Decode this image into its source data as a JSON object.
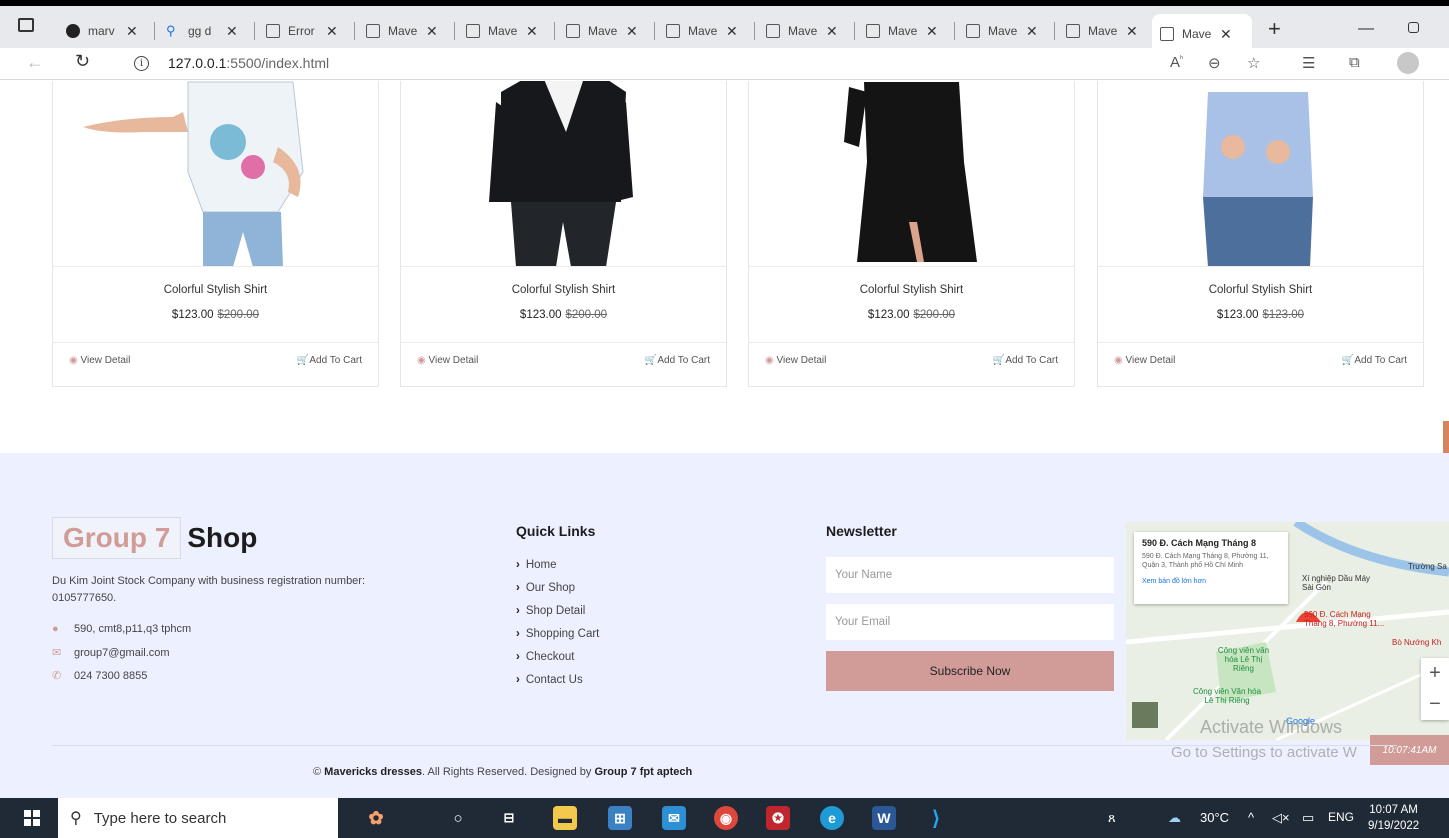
{
  "browser": {
    "tabs": [
      {
        "label": "marv",
        "icon": "github-icon"
      },
      {
        "label": "gg d",
        "icon": "search-icon"
      },
      {
        "label": "Error",
        "icon": "page-icon"
      },
      {
        "label": "Mave",
        "icon": "page-icon"
      },
      {
        "label": "Mave",
        "icon": "page-icon"
      },
      {
        "label": "Mave",
        "icon": "page-icon"
      },
      {
        "label": "Mave",
        "icon": "page-icon"
      },
      {
        "label": "Mave",
        "icon": "page-icon"
      },
      {
        "label": "Mave",
        "icon": "page-icon"
      },
      {
        "label": "Mave",
        "icon": "page-icon"
      },
      {
        "label": "Mave",
        "icon": "page-icon"
      },
      {
        "label": "Mave",
        "icon": "page-icon",
        "active": true
      }
    ],
    "url_host": "127.0.0.1",
    "url_path": ":5500/index.html"
  },
  "products": [
    {
      "name": "Colorful Stylish Shirt",
      "price": "$123.00",
      "old_price": "$200.00",
      "view": "View Detail",
      "cart": "Add To Cart"
    },
    {
      "name": "Colorful Stylish Shirt",
      "price": "$123.00",
      "old_price": "$200.00",
      "view": "View Detail",
      "cart": "Add To Cart"
    },
    {
      "name": "Colorful Stylish Shirt",
      "price": "$123.00",
      "old_price": "$200.00",
      "view": "View Detail",
      "cart": "Add To Cart"
    },
    {
      "name": "Colorful Stylish Shirt",
      "price": "$123.00",
      "old_price": "$123.00",
      "view": "View Detail",
      "cart": "Add To Cart"
    }
  ],
  "footer": {
    "logo_accent": "Group 7",
    "logo_rest": "Shop",
    "about": "Du Kim Joint Stock Company with business registration number: 0105777650.",
    "address": "590, cmt8,p11,q3 tphcm",
    "email": "group7@gmail.com",
    "phone": "024 7300 8855",
    "quick_links_title": "Quick Links",
    "quick_links": [
      "Home",
      "Our Shop",
      "Shop Detail",
      "Shopping Cart",
      "Checkout",
      "Contact Us"
    ],
    "newsletter_title": "Newsletter",
    "name_placeholder": "Your Name",
    "email_placeholder": "Your Email",
    "subscribe": "Subscribe Now",
    "copyright_symbol": "©",
    "copyright_brand": "Mavericks dresses",
    "copyright_mid": ". All Rights Reserved. Designed by",
    "copyright_designer": "Group 7 fpt aptech",
    "map": {
      "title": "590 Đ. Cách Mạng Tháng 8",
      "address": "590 Đ. Cách Mạng Tháng 8, Phường 11, Quận 3, Thành phố Hồ Chí Minh",
      "link": "Xem bản đồ lớn hơn",
      "pin_label": "590 Đ. Cách Mạng Tháng 8, Phường 11...",
      "place1": "Xí nghiệp Dầu Máy Sài Gòn",
      "park1": "Công viên văn hóa Lê Thị Riêng",
      "park2": "Công viên Văn hóa Lê Thị Riêng",
      "road": "Trường Sa",
      "bo_nuong": "Bò Nướng Kh",
      "google": "Google"
    },
    "activate_line1": "Activate Windows",
    "activate_line2": "Go to Settings to activate W",
    "clock_badge": "10:07:41AM"
  },
  "taskbar": {
    "search_placeholder": "Type here to search",
    "weather": "30°C",
    "lang": "ENG",
    "time": "10:07 AM",
    "date": "9/19/2022"
  },
  "colors": {
    "accent": "#d19c97",
    "footer_bg": "#edf1ff",
    "taskbar": "#1f2a36"
  }
}
